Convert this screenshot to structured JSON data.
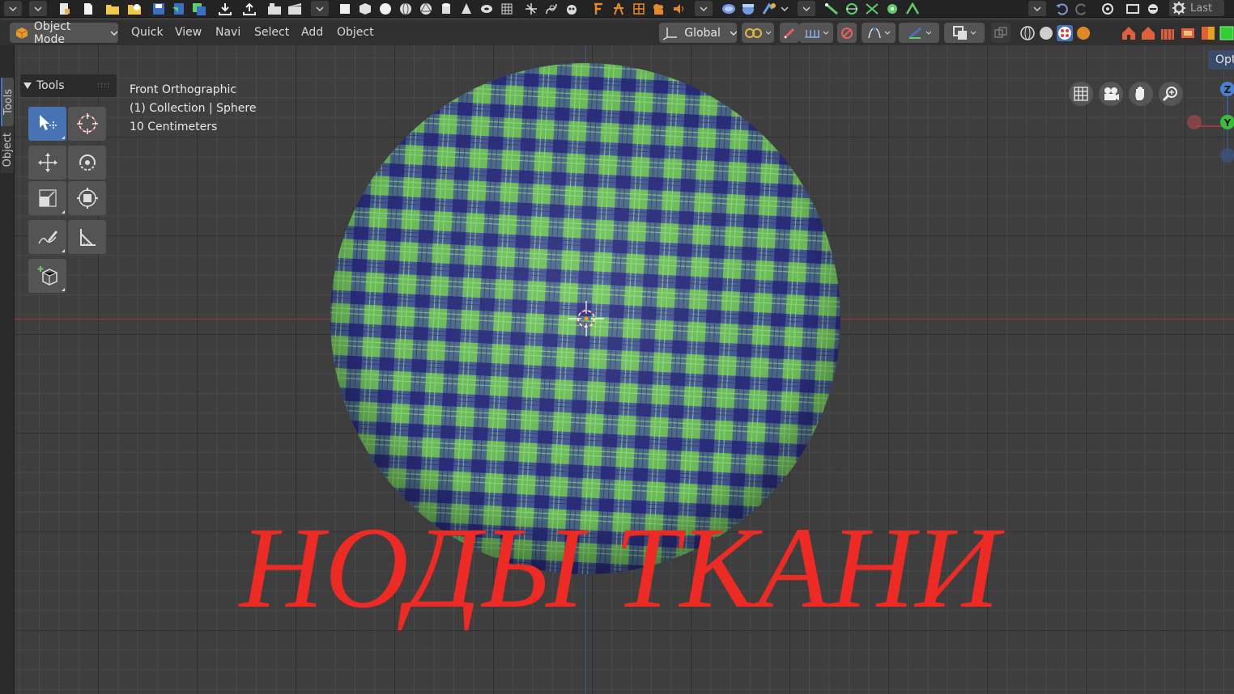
{
  "header": {
    "mode_label": "Object Mode",
    "menus": [
      "Quick",
      "View",
      "Navi",
      "Select",
      "Add",
      "Object"
    ],
    "orientation_label": "Global"
  },
  "top_toolbar": {
    "last_label": "Last"
  },
  "side_tabs": {
    "tools": "Tools",
    "object": "Object"
  },
  "tools_panel": {
    "title": "Tools",
    "tools": [
      "select-box",
      "cursor",
      "move",
      "rotate",
      "scale",
      "transform",
      "annotate",
      "measure",
      "add-cube"
    ]
  },
  "viewport": {
    "view_name": "Front Orthographic",
    "collection_info": "(1) Collection | Sphere",
    "scale_info": "10 Centimeters",
    "options_label": "Opt",
    "gizmo_axes": [
      "Z",
      "Y"
    ]
  },
  "overlay_title": "НОДЫ ТКАНИ",
  "colors": {
    "accent": "#4772b3",
    "title_red": "#ee2a24",
    "plaid_green": "#7fd067",
    "plaid_blue": "#3a3f93"
  }
}
